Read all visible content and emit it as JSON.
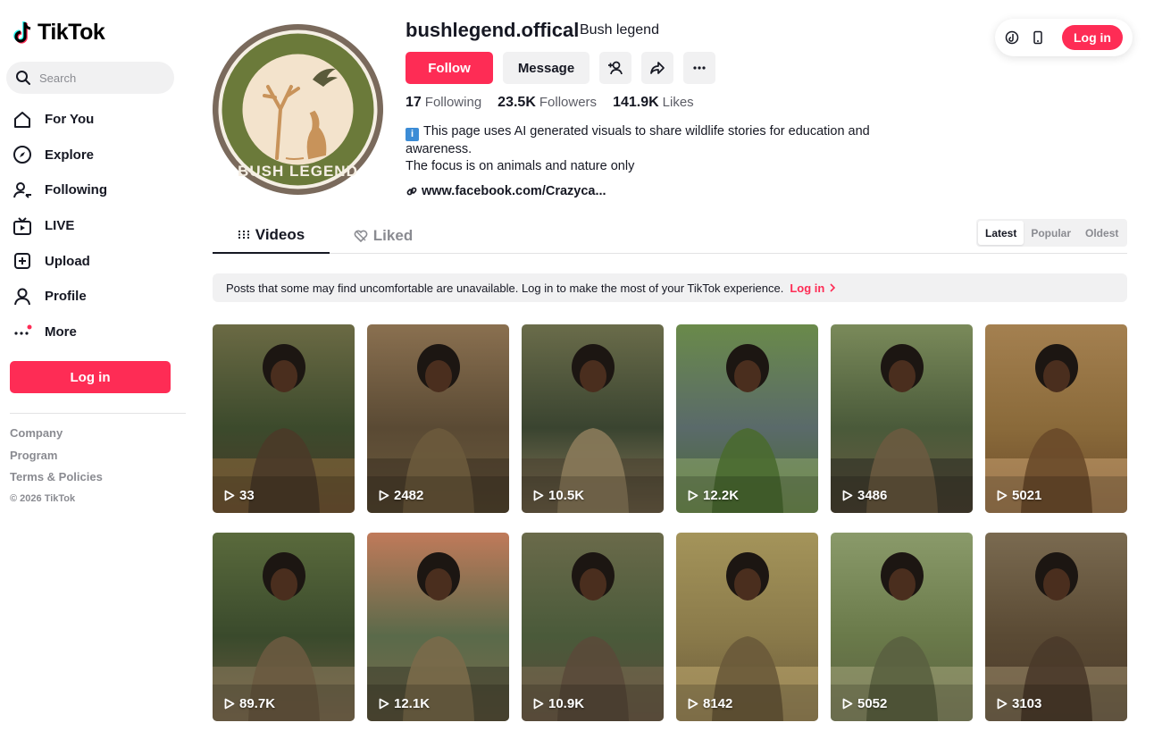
{
  "brand": {
    "name": "TikTok"
  },
  "search": {
    "placeholder": "Search"
  },
  "nav": [
    {
      "label": "For You",
      "icon": "home-icon"
    },
    {
      "label": "Explore",
      "icon": "compass-icon"
    },
    {
      "label": "Following",
      "icon": "following-icon"
    },
    {
      "label": "LIVE",
      "icon": "live-tv-icon"
    },
    {
      "label": "Upload",
      "icon": "upload-icon"
    },
    {
      "label": "Profile",
      "icon": "profile-icon"
    },
    {
      "label": "More",
      "icon": "more-dots-icon"
    }
  ],
  "sidebar": {
    "login_label": "Log in",
    "footer": [
      "Company",
      "Program",
      "Terms & Policies"
    ],
    "copyright": "© 2026 TikTok"
  },
  "profile": {
    "avatar_text": "BUSH LEGEND",
    "username": "bushlegend.offical",
    "nickname": "Bush legend",
    "follow_label": "Follow",
    "message_label": "Message",
    "stats": {
      "following": "17",
      "following_label": "Following",
      "followers": "23.5K",
      "followers_label": "Followers",
      "likes": "141.9K",
      "likes_label": "Likes"
    },
    "bio_line1": "This page uses AI generated visuals to share wildlife stories for education and awareness.",
    "bio_line2": "The focus is on animals and nature only",
    "link": "www.facebook.com/Crazyca..."
  },
  "topbar": {
    "login_label": "Log in"
  },
  "tabs": {
    "videos": "Videos",
    "liked": "Liked"
  },
  "sort": {
    "options": [
      "Latest",
      "Popular",
      "Oldest"
    ],
    "selected": "Latest"
  },
  "notice": {
    "text": "Posts that some may find uncomfortable are unavailable. Log in to make the most of your TikTok experience.",
    "login_label": "Log in"
  },
  "videos": [
    {
      "views": "33"
    },
    {
      "views": "2482"
    },
    {
      "views": "10.5K"
    },
    {
      "views": "12.2K"
    },
    {
      "views": "3486"
    },
    {
      "views": "5021"
    },
    {
      "views": "89.7K"
    },
    {
      "views": "12.1K"
    },
    {
      "views": "10.9K"
    },
    {
      "views": "8142"
    },
    {
      "views": "5052"
    },
    {
      "views": "3103"
    }
  ],
  "colors": {
    "accent": "#fe2c55",
    "text": "#161823",
    "muted": "#8a8b91",
    "badge_olive": "#6b7a3a"
  }
}
